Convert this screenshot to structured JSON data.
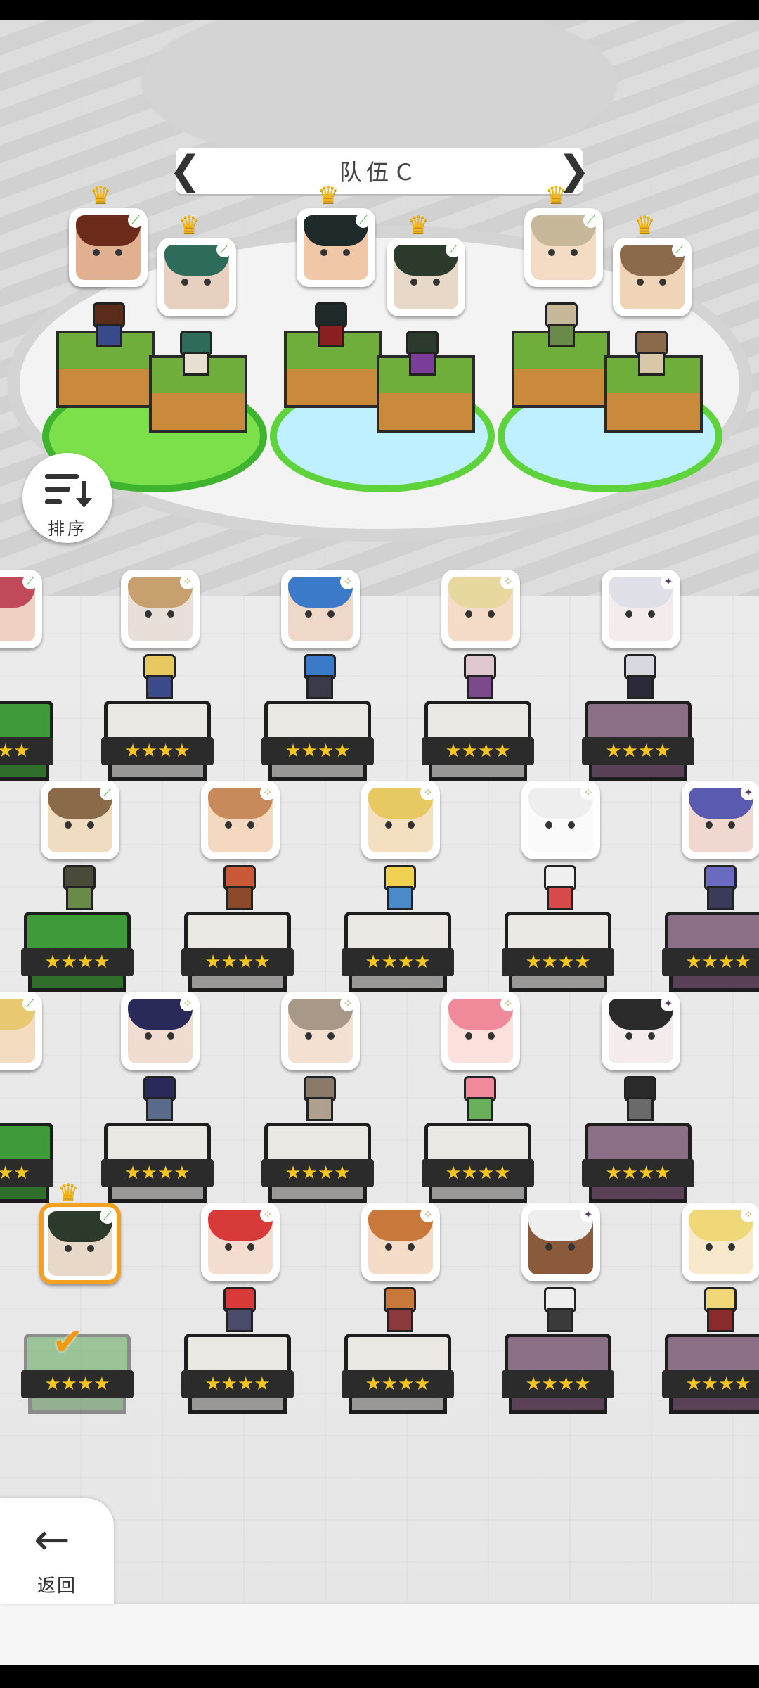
{
  "team": {
    "title": "队伍Ｃ",
    "prev_icon": "chevron-left-icon",
    "next_icon": "chevron-right-icon"
  },
  "sort_button": {
    "label": "排序",
    "icon": "sort-icon"
  },
  "back_button": {
    "label": "返回",
    "icon": "arrow-left-icon"
  },
  "star_glyphs": "★★★★",
  "colors": {
    "crown": "#f5b50f",
    "selected_border": "#f4a020",
    "grass_badge": "#3fb52f",
    "light_badge": "#d0d0a0",
    "dark_badge": "#5b3a66"
  },
  "team_members": [
    {
      "element": "grass",
      "leader": true
    },
    {
      "element": "grass",
      "leader": true
    },
    {
      "element": "grass",
      "leader": true
    },
    {
      "element": "grass",
      "leader": true
    },
    {
      "element": "grass",
      "leader": true
    },
    {
      "element": "grass",
      "leader": true
    }
  ],
  "roster": [
    {
      "rarity": 4,
      "element": "grass",
      "partial": true
    },
    {
      "rarity": 4,
      "element": "light"
    },
    {
      "rarity": 4,
      "element": "light"
    },
    {
      "rarity": 4,
      "element": "light"
    },
    {
      "rarity": 4,
      "element": "dark"
    },
    {
      "rarity": 4,
      "element": "grass"
    },
    {
      "rarity": 4,
      "element": "light"
    },
    {
      "rarity": 4,
      "element": "light"
    },
    {
      "rarity": 4,
      "element": "light"
    },
    {
      "rarity": 4,
      "element": "dark"
    },
    {
      "rarity": 4,
      "element": "grass",
      "partial": true
    },
    {
      "rarity": 4,
      "element": "light"
    },
    {
      "rarity": 4,
      "element": "light"
    },
    {
      "rarity": 4,
      "element": "light"
    },
    {
      "rarity": 4,
      "element": "dark"
    },
    {
      "rarity": 4,
      "element": "grass",
      "leader": true,
      "selected": true
    },
    {
      "rarity": 4,
      "element": "light"
    },
    {
      "rarity": 4,
      "element": "light"
    },
    {
      "rarity": 4,
      "element": "dark"
    },
    {
      "rarity": 4,
      "element": "light"
    }
  ]
}
